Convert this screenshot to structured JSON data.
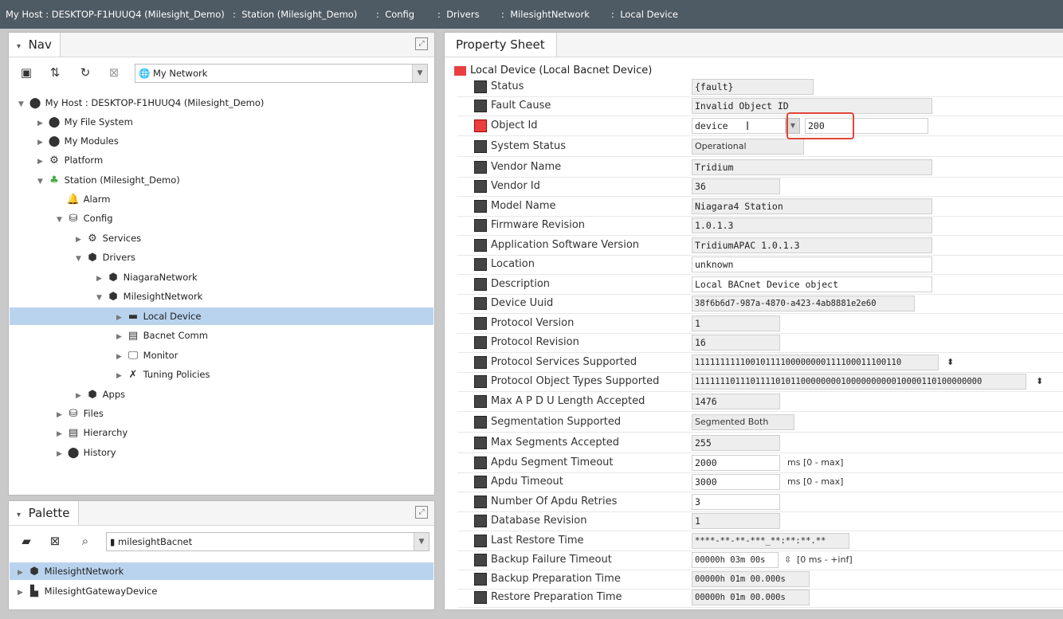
{
  "path": [
    "My Host : DESKTOP-F1HUUQ4 (Milesight_Demo)",
    "Station (Milesight_Demo)",
    "Config",
    "Drivers",
    "MilesightNetwork",
    "Local Device"
  ],
  "nav": {
    "title": "Nav",
    "network_combo": "My Network",
    "tree": [
      {
        "label": "My Host : DESKTOP-F1HUUQ4 (Milesight_Demo)",
        "icon": "host-icon"
      },
      {
        "label": "My File System",
        "icon": "filesystem-icon"
      },
      {
        "label": "My Modules",
        "icon": "modules-icon"
      },
      {
        "label": "Platform",
        "icon": "platform-icon"
      },
      {
        "label": "Station (Milesight_Demo)",
        "icon": "station-icon"
      },
      {
        "label": "Alarm",
        "icon": "bell-icon"
      },
      {
        "label": "Config",
        "icon": "config-icon"
      },
      {
        "label": "Services",
        "icon": "services-icon"
      },
      {
        "label": "Drivers",
        "icon": "drivers-icon"
      },
      {
        "label": "NiagaraNetwork",
        "icon": "network-icon"
      },
      {
        "label": "MilesightNetwork",
        "icon": "network-icon"
      },
      {
        "label": "Local Device",
        "icon": "device-icon"
      },
      {
        "label": "Bacnet Comm",
        "icon": "comm-icon"
      },
      {
        "label": "Monitor",
        "icon": "monitor-icon"
      },
      {
        "label": "Tuning Policies",
        "icon": "tuning-icon"
      },
      {
        "label": "Apps",
        "icon": "apps-icon"
      },
      {
        "label": "Files",
        "icon": "files-icon"
      },
      {
        "label": "Hierarchy",
        "icon": "hierarchy-icon"
      },
      {
        "label": "History",
        "icon": "history-icon"
      }
    ]
  },
  "palette": {
    "title": "Palette",
    "combo": "milesightBacnet",
    "items": [
      {
        "label": "MilesightNetwork"
      },
      {
        "label": "MilesightGatewayDevice"
      }
    ]
  },
  "sheet": {
    "tab": "Property Sheet",
    "header": "Local Device  (Local Bacnet Device)",
    "rows": [
      {
        "name": "Status",
        "value": "{fault}"
      },
      {
        "name": "Fault Cause",
        "value": "Invalid Object ID"
      },
      {
        "name": "Object Id",
        "value": "device",
        "value2": "200"
      },
      {
        "name": "System Status",
        "value": "Operational"
      },
      {
        "name": "Vendor Name",
        "value": "Tridium"
      },
      {
        "name": "Vendor Id",
        "value": "36"
      },
      {
        "name": "Model Name",
        "value": "Niagara4 Station"
      },
      {
        "name": "Firmware Revision",
        "value": "1.0.1.3"
      },
      {
        "name": "Application Software Version",
        "value": "TridiumAPAC 1.0.1.3"
      },
      {
        "name": "Location",
        "value": "unknown"
      },
      {
        "name": "Description",
        "value": "Local BACnet Device object"
      },
      {
        "name": "Device Uuid",
        "value": "38f6b6d7-987a-4870-a423-4ab8881e2e60"
      },
      {
        "name": "Protocol Version",
        "value": "1"
      },
      {
        "name": "Protocol Revision",
        "value": "16"
      },
      {
        "name": "Protocol Services Supported",
        "value": "11111111110010111100000000111100011100110"
      },
      {
        "name": "Protocol Object Types Supported",
        "value": "111111101110111101011000000001000000000010000110100000000"
      },
      {
        "name": "Max A P D U Length Accepted",
        "value": "1476"
      },
      {
        "name": "Segmentation Supported",
        "value": "Segmented Both"
      },
      {
        "name": "Max Segments Accepted",
        "value": "255"
      },
      {
        "name": "Apdu Segment Timeout",
        "value": "2000",
        "unit": "ms [0 - max]"
      },
      {
        "name": "Apdu Timeout",
        "value": "3000",
        "unit": "ms [0 - max]"
      },
      {
        "name": "Number Of Apdu Retries",
        "value": "3"
      },
      {
        "name": "Database Revision",
        "value": "1"
      },
      {
        "name": "Last Restore Time",
        "value": "****-**-**-***_**:**:**.**"
      },
      {
        "name": "Backup Failure Timeout",
        "value": "00000h 03m 00s",
        "unit": "[0 ms - +inf]"
      },
      {
        "name": "Backup Preparation Time",
        "value": "00000h 01m 00.000s"
      },
      {
        "name": "Restore Preparation Time",
        "value": "00000h 01m 00.000s"
      }
    ]
  }
}
